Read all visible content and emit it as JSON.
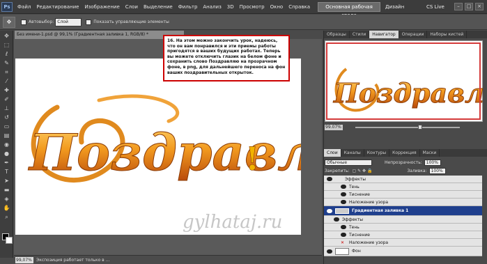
{
  "menubar": {
    "app_logo": "Ps",
    "items": [
      "Файл",
      "Редактирование",
      "Изображение",
      "Слои",
      "Выделение",
      "Фильтр",
      "Анализ",
      "3D",
      "Просмотр",
      "Окно",
      "Справка"
    ],
    "zoom": "99,1",
    "workspace_button": "Основная рабочая среда",
    "design_button": "Дизайн",
    "cslive": "CS Live"
  },
  "options": {
    "autoselect_label": "Автовыбор:",
    "autoselect_value": "Слой",
    "show_controls_label": "Показать управляющие элементы"
  },
  "document": {
    "tab_title": "Без имени-1.psd @ 99,1% (Градиентная заливка 1, RGB/8) *",
    "canvas_text": "Поздравляю!",
    "watermark": "gylhataj.ru",
    "status_zoom": "99,07%",
    "status_text": "Экспозиция работает только в ..."
  },
  "note": {
    "text": "16. На этом можно закончить урок, надеюсь, что он вам понравился и эти приемы работы пригодятся в ваших будущих работах. Теперь вы можете отключить глазик на белом фоне и сохранить слово Поздравляю на прозрачном фоне, в png, для дальнейшего переноса на фон ваших поздравительных открыток."
  },
  "navigator": {
    "tabs": [
      "Образцы",
      "Стили",
      "Навигатор",
      "Операции",
      "Наборы кистей"
    ],
    "active_tab": "Навигатор",
    "zoom": "99.07%"
  },
  "layers": {
    "tabs": [
      "Слои",
      "Каналы",
      "Контуры",
      "Коррекция",
      "Маски"
    ],
    "blend_mode": "Обычные",
    "opacity_label": "Непрозрачность:",
    "opacity_value": "100%",
    "lock_label": "Закрепить:",
    "fill_label": "Заливка:",
    "fill_value": "100%",
    "rows": [
      {
        "label": "Эффекты"
      },
      {
        "label": "Тень"
      },
      {
        "label": "Тиснение"
      },
      {
        "label": "Наложение узора"
      },
      {
        "label": "Градиентная заливка 1"
      },
      {
        "label": "Эффекты"
      },
      {
        "label": "Тень"
      },
      {
        "label": "Тиснение"
      },
      {
        "label": "Наложение узора"
      },
      {
        "label": "Фон"
      }
    ]
  }
}
